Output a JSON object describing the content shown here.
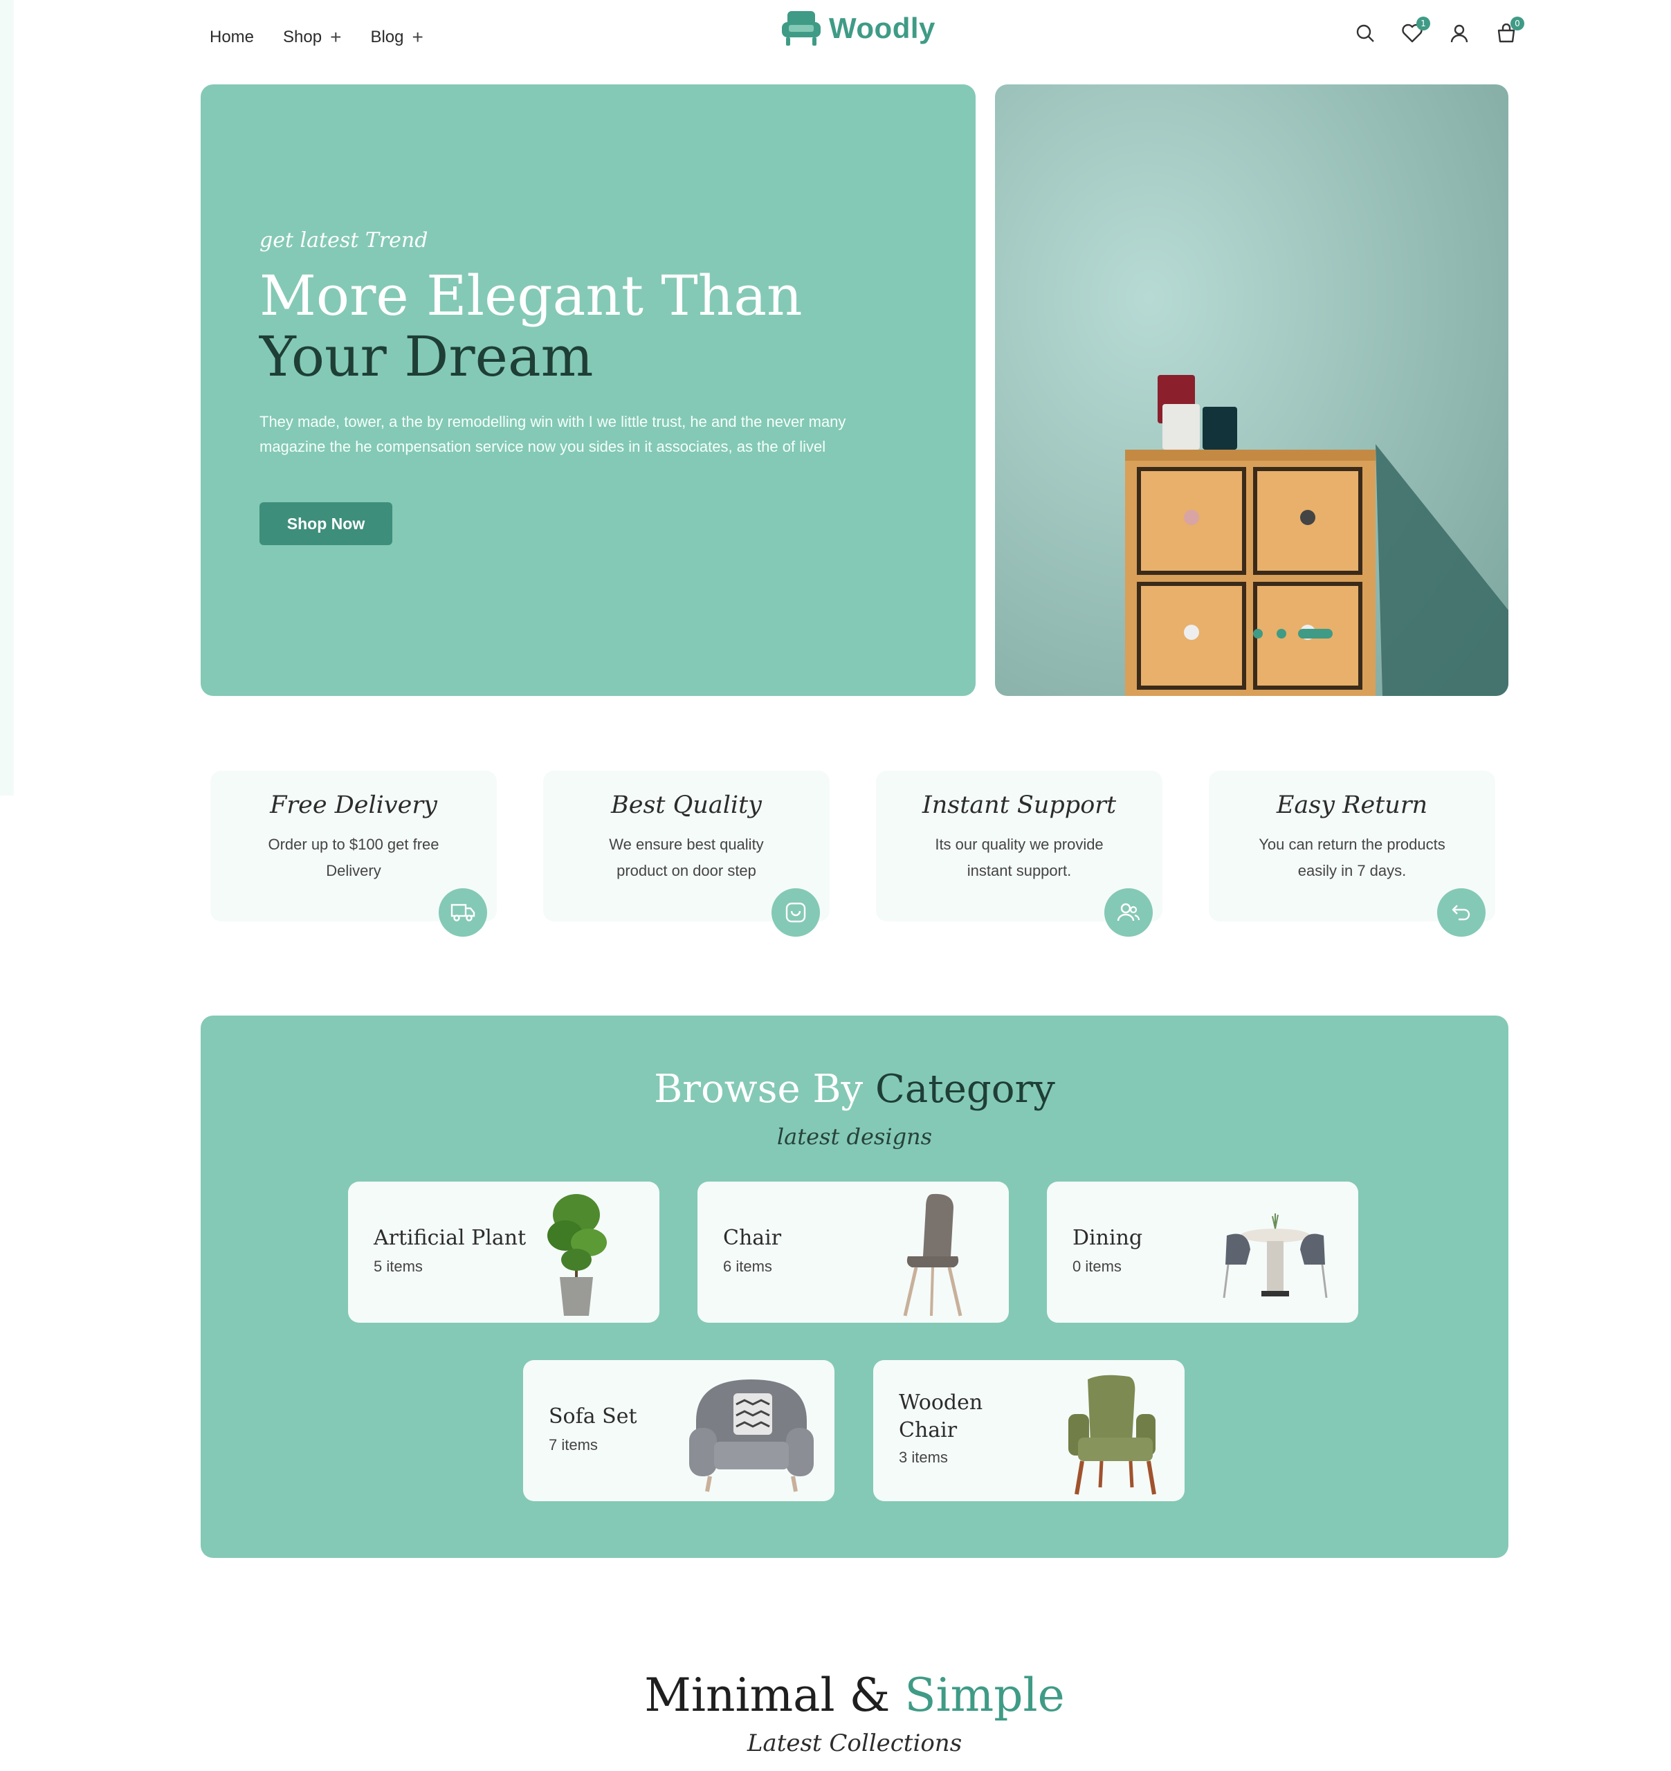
{
  "nav": {
    "home": "Home",
    "shop": "Shop",
    "blog": "Blog"
  },
  "logo": {
    "text": "Woodly"
  },
  "header_icons": {
    "search": "search-icon",
    "wishlist": "heart-icon",
    "wishlist_count": "1",
    "account": "user-icon",
    "cart": "cart-icon",
    "cart_count": "0"
  },
  "hero": {
    "subtitle": "get latest Trend",
    "title_line1": "More Elegant Than",
    "title_line2": "Your Dream",
    "description": "They made, tower, a the by remodelling win with I we little trust, he and the never many magazine the he compensation service now you sides in it associates, as the of livel",
    "button": "Shop Now"
  },
  "features": [
    {
      "title": "Free Delivery",
      "desc": "Order up to $100 get free Delivery",
      "icon": "truck-icon"
    },
    {
      "title": "Best Quality",
      "desc": "We ensure best quality product on door step",
      "icon": "badge-icon"
    },
    {
      "title": "Instant Support",
      "desc": "Its our quality we provide instant support.",
      "icon": "support-users-icon"
    },
    {
      "title": "Easy Return",
      "desc": "You can return the products easily in 7 days.",
      "icon": "return-icon"
    }
  ],
  "category": {
    "title_part1": "Browse By",
    "title_part2": "Category",
    "subtitle": "latest designs",
    "items": [
      {
        "name": "Artificial Plant",
        "count": "5 items"
      },
      {
        "name": "Chair",
        "count": "6 items"
      },
      {
        "name": "Dining",
        "count": "0 items"
      },
      {
        "name": "Sofa Set",
        "count": "7 items"
      },
      {
        "name_line1": "Wooden",
        "name_line2": "Chair",
        "count": "3 items"
      }
    ]
  },
  "collections": {
    "title_part1": "Minimal &",
    "title_part2": "Simple",
    "subtitle": "Latest Collections"
  },
  "colors": {
    "accent": "#84c9b5",
    "brand": "#3f9b86",
    "dark": "#1e3e36"
  }
}
